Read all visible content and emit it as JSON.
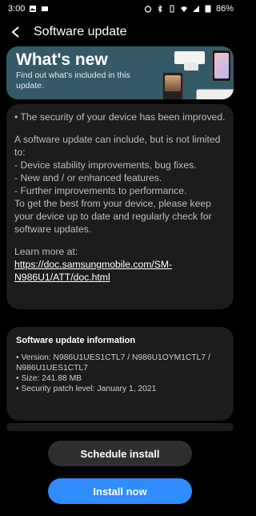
{
  "status": {
    "time": "3:00",
    "battery": "86%"
  },
  "header": {
    "title": "Software update"
  },
  "whats_new": {
    "title": "What's new",
    "subtitle": "Find out what's included in this update."
  },
  "notes": {
    "p1": "• The security of your device has been improved.",
    "p2": "A software update can include, but is not limited to:",
    "p3": " - Device stability improvements, bug fixes.",
    "p4": " - New and / or enhanced features.",
    "p5": " - Further improvements to performance.",
    "p6": "To get the best from your device, please keep your device up to date and regularly check for software updates.",
    "learn": "Learn more at:",
    "link": "https://doc.samsungmobile.com/SM-N986U1/ATT/doc.html"
  },
  "info": {
    "title": "Software update information",
    "version": "• Version: N986U1UES1CTL7 / N986U1OYM1CTL7 / N986U1UES1CTL7",
    "size": "• Size: 241.88 MB",
    "patch": "• Security patch level: January 1, 2021"
  },
  "buttons": {
    "schedule": "Schedule install",
    "install": "Install now"
  },
  "colors": {
    "accent": "#2f8dff",
    "whats_new_bg": "#355a67",
    "card_bg": "#1c1c1c"
  },
  "icons": [
    "back-arrow-icon",
    "alarm-icon",
    "vibrate-icon",
    "bluetooth-icon",
    "wifi-icon",
    "signal-icon",
    "battery-icon"
  ]
}
